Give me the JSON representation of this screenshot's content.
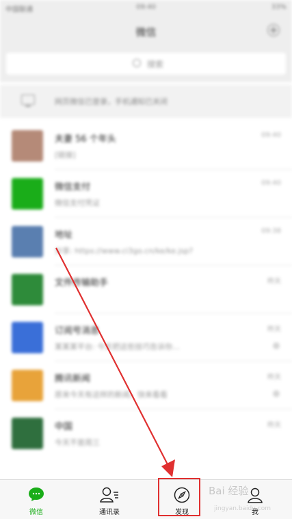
{
  "status_bar": {
    "carrier": "中国联通",
    "time": "09:40",
    "battery": "33%"
  },
  "header": {
    "title": "微信"
  },
  "search": {
    "placeholder": "搜索"
  },
  "pc_notice": {
    "text": "网页微信已登录，手机通知已关闭"
  },
  "chats": [
    {
      "name": "夫妻 56 个年头",
      "message": "[链接]",
      "time": "09:40",
      "avatar_color": "#b58a78"
    },
    {
      "name": "微信支付",
      "message": "微信支付凭证",
      "time": "09:40",
      "avatar_color": "#1aad19"
    },
    {
      "name": "地址",
      "message": "分享: https://www.ci3go.cn/ke/ke.jsp?",
      "time": "09:38",
      "avatar_color": "#5a7fb0"
    },
    {
      "name": "文件传输助手",
      "message": "",
      "time": "昨天",
      "avatar_color": "#2e8b3a"
    },
    {
      "name": "订阅号消息",
      "message": "某某某平台: 今天把这些技巧告诉你...",
      "time": "昨天",
      "avatar_color": "#3a6fd8"
    },
    {
      "name": "腾讯新闻",
      "message": "原来今天有这样的新闻，快来看看",
      "time": "昨天",
      "avatar_color": "#e8a33a"
    },
    {
      "name": "中国",
      "message": "今天不是周三",
      "time": "昨天",
      "avatar_color": "#2f6f3e"
    }
  ],
  "tabs": [
    {
      "label": "微信",
      "icon": "chat-bubble-icon",
      "active": true
    },
    {
      "label": "通讯录",
      "icon": "contacts-icon",
      "active": false
    },
    {
      "label": "发现",
      "icon": "compass-icon",
      "active": false
    },
    {
      "label": "我",
      "icon": "person-icon",
      "active": false
    }
  ],
  "watermark": {
    "text": "Bai 经验",
    "sub": "jingyan.baidu.com"
  },
  "colors": {
    "accent": "#1aad19",
    "annotation": "#e03030"
  }
}
